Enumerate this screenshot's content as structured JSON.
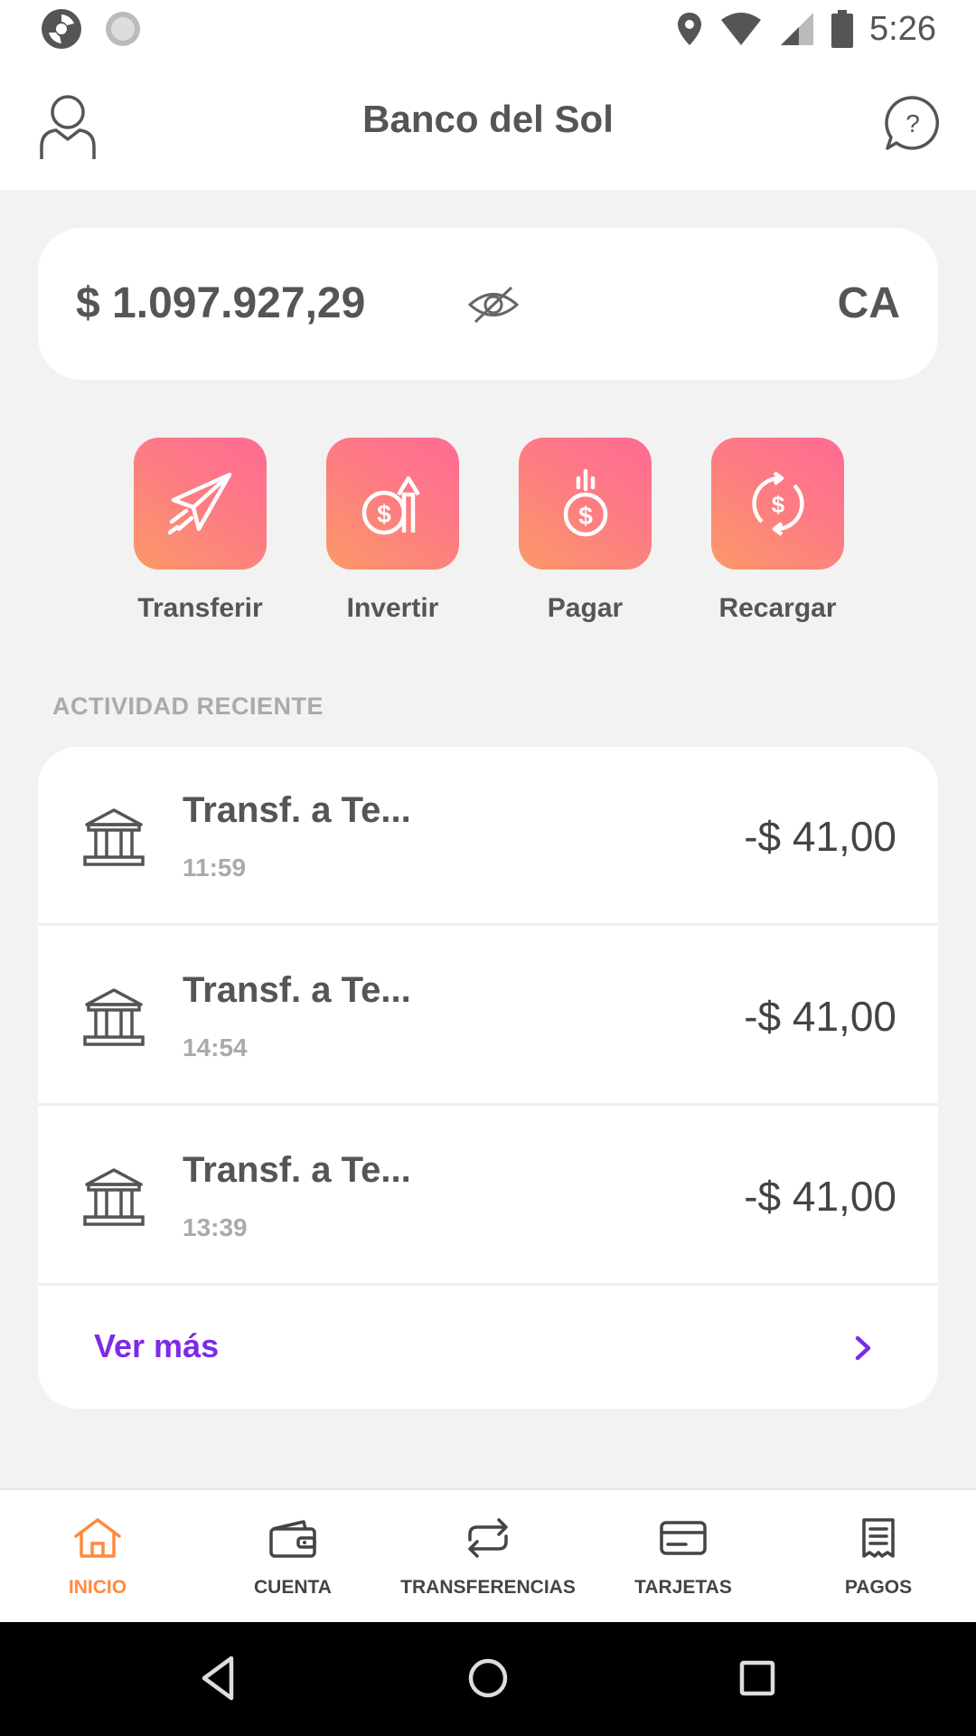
{
  "status_bar": {
    "time": "5:26",
    "icons": [
      "app-notification-icon",
      "sync-notification-icon",
      "location-icon",
      "wifi-icon",
      "signal-icon",
      "battery-icon"
    ]
  },
  "header": {
    "title": "Banco del Sol",
    "profile_icon": "user-icon",
    "help_icon": "help-icon"
  },
  "balance": {
    "amount": "$ 1.097.927,29",
    "account_type": "CA",
    "visibility_icon": "eye-off-icon"
  },
  "actions": [
    {
      "label": "Transferir",
      "icon": "paper-plane-icon"
    },
    {
      "label": "Invertir",
      "icon": "invest-coin-icon"
    },
    {
      "label": "Pagar",
      "icon": "pay-coin-icon"
    },
    {
      "label": "Recargar",
      "icon": "recharge-coin-icon"
    }
  ],
  "recent_activity": {
    "title": "ACTIVIDAD RECIENTE",
    "items": [
      {
        "name": "Transf. a Te...",
        "time": "11:59",
        "amount": "-$ 41,00"
      },
      {
        "name": "Transf. a Te...",
        "time": "14:54",
        "amount": "-$ 41,00"
      },
      {
        "name": "Transf. a Te...",
        "time": "13:39",
        "amount": "-$ 41,00"
      }
    ],
    "see_more": "Ver más"
  },
  "bottom_nav": [
    {
      "label": "INICIO",
      "icon": "home-icon",
      "active": true
    },
    {
      "label": "CUENTA",
      "icon": "wallet-icon",
      "active": false
    },
    {
      "label": "TRANSFERENCIAS",
      "icon": "transfer-icon",
      "active": false
    },
    {
      "label": "TARJETAS",
      "icon": "card-icon",
      "active": false
    },
    {
      "label": "PAGOS",
      "icon": "receipt-icon",
      "active": false
    }
  ],
  "colors": {
    "accent_orange": "#ff8a3d",
    "gradient_start": "#fb9966",
    "gradient_end": "#ff6b93",
    "link_purple": "#7d2ae8",
    "background": "#f2f2f2"
  }
}
